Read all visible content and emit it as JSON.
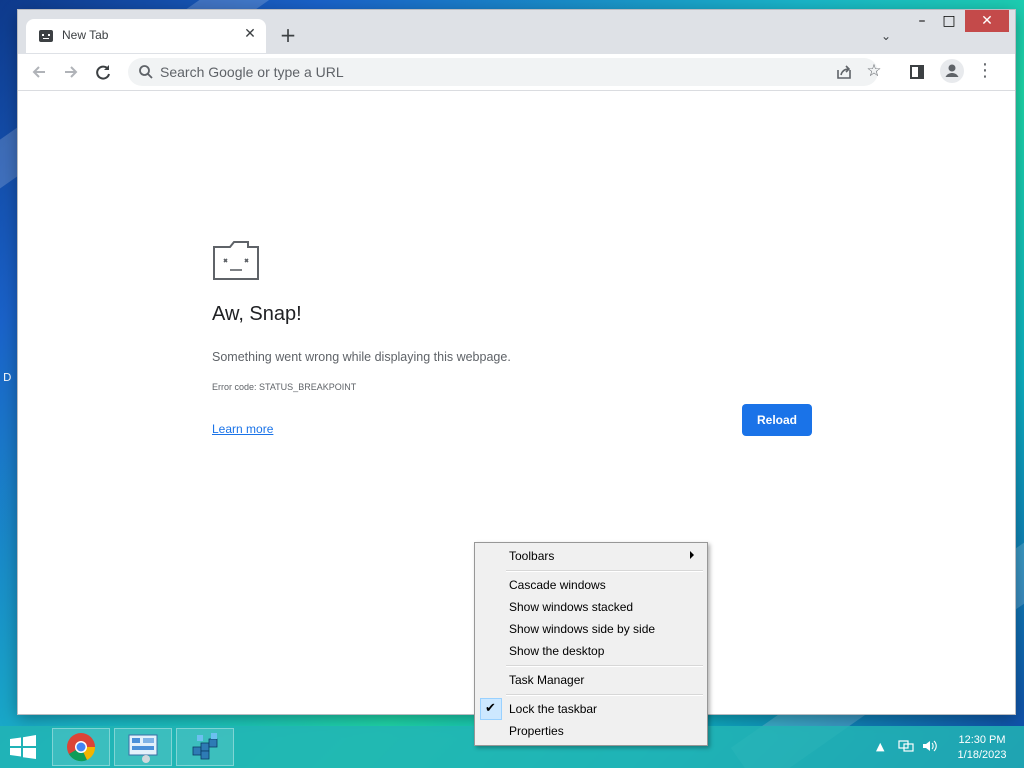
{
  "browser": {
    "tab": {
      "title": "New Tab",
      "close": "✕"
    },
    "new_tab": "+",
    "tab_search": "⌄",
    "window_controls": {
      "minimize": "–",
      "maximize": "□",
      "close": "✕"
    },
    "omnibox": {
      "placeholder": "Search Google or type a URL"
    },
    "toolbar_icons": [
      "back-arrow-icon",
      "forward-arrow-icon",
      "reload-icon",
      "share-icon",
      "star-icon",
      "side-panel-icon",
      "profile-icon",
      "menu-icon"
    ]
  },
  "error_page": {
    "title": "Aw, Snap!",
    "message": "Something went wrong while displaying this webpage.",
    "error_code": "Error code: STATUS_BREAKPOINT",
    "learn_more": "Learn more",
    "reload": "Reload"
  },
  "desktop": {
    "label": "D"
  },
  "taskbar": {
    "apps": [
      "chrome-icon",
      "control-panel-icon",
      "registry-editor-icon"
    ],
    "clock": {
      "time": "12:30 PM",
      "date": "1/18/2023"
    }
  },
  "context_menu": {
    "items": [
      {
        "label": "Toolbars",
        "submenu": true
      },
      {
        "label": "Cascade windows"
      },
      {
        "label": "Show windows stacked"
      },
      {
        "label": "Show windows side by side"
      },
      {
        "label": "Show the desktop"
      },
      {
        "label": "Task Manager"
      },
      {
        "label": "Lock the taskbar",
        "checked": true
      },
      {
        "label": "Properties"
      }
    ]
  },
  "colors": {
    "accent": "#1a73e8",
    "taskbar": "#22b4b4",
    "menu_bg": "#f0f0f0"
  }
}
